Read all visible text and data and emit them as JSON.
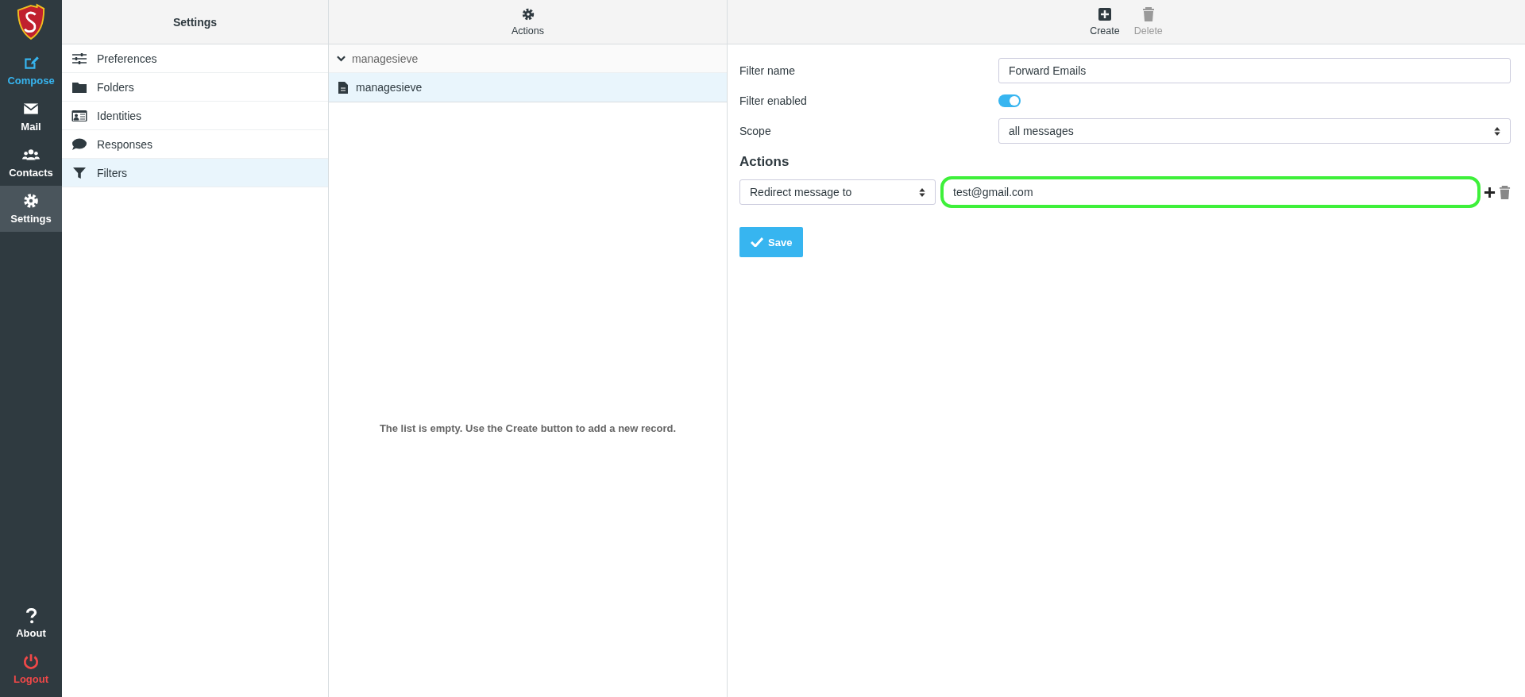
{
  "nav": {
    "items": [
      {
        "kind": "compose",
        "label": "Compose",
        "selected": false,
        "accent": true
      },
      {
        "kind": "mail",
        "label": "Mail",
        "selected": false,
        "accent": false
      },
      {
        "kind": "contacts",
        "label": "Contacts",
        "selected": false,
        "accent": false
      },
      {
        "kind": "settings",
        "label": "Settings",
        "selected": true,
        "accent": false
      }
    ],
    "bottom": [
      {
        "kind": "about",
        "label": "About",
        "selected": false
      },
      {
        "kind": "logout",
        "label": "Logout",
        "selected": false
      }
    ]
  },
  "settings": {
    "title": "Settings",
    "items": [
      {
        "kind": "sliders",
        "label": "Preferences",
        "selected": false
      },
      {
        "kind": "folder",
        "label": "Folders",
        "selected": false
      },
      {
        "kind": "idcard",
        "label": "Identities",
        "selected": false
      },
      {
        "kind": "comment",
        "label": "Responses",
        "selected": false
      },
      {
        "kind": "filter",
        "label": "Filters",
        "selected": true
      }
    ]
  },
  "filter_sets": {
    "toolbar": {
      "label": "Actions"
    },
    "group": {
      "label": "managesieve",
      "expanded": true,
      "children": [
        {
          "label": "managesieve",
          "selected": true
        }
      ]
    },
    "empty_message": "The list is empty. Use the Create button to add a new record."
  },
  "editor": {
    "toolbar": [
      {
        "kind": "create",
        "label": "Create",
        "disabled": false
      },
      {
        "kind": "delete",
        "label": "Delete",
        "disabled": true
      }
    ],
    "fields": [
      {
        "kind": "text",
        "label": "Filter name",
        "value": "Forward Emails"
      },
      {
        "kind": "toggle",
        "label": "Filter enabled",
        "on": true
      },
      {
        "kind": "select",
        "label": "Scope",
        "value": "all messages"
      }
    ],
    "actions_heading": "Actions",
    "action": {
      "type": "Redirect message to",
      "value": "test@gmail.com",
      "highlighted": true
    },
    "save": "Save"
  }
}
